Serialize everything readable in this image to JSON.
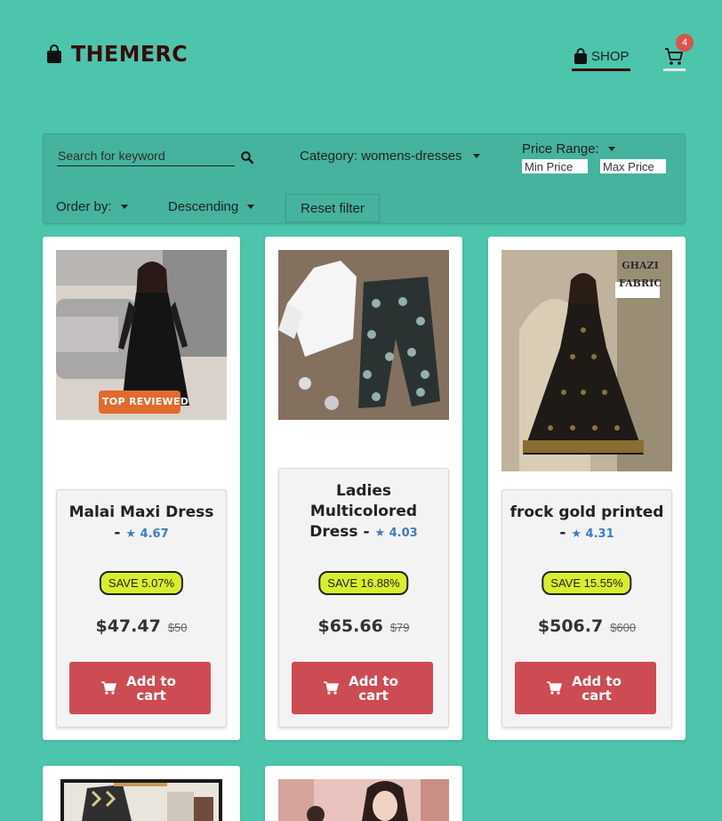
{
  "brand": {
    "name": "THEMERC",
    "icon": "shopping-bag-icon"
  },
  "nav": {
    "shop_label": "SHOP",
    "cart_count": "4"
  },
  "filters": {
    "search_placeholder": "Search for keyword",
    "category_label": "Category: womens-dresses",
    "price_range_label": "Price Range:",
    "min_price_placeholder": "Min Price",
    "max_price_placeholder": "Max Price",
    "order_by_label": "Order by:",
    "direction_label": "Descending",
    "reset_label": "Reset filter"
  },
  "products": [
    {
      "name": "Malai Maxi Dress",
      "rating": "★ 4.67",
      "save": "SAVE 5.07%",
      "price": "$47.47",
      "old_price": "$50",
      "add_label": "Add to cart",
      "image_badge": "TOP REVIEWED"
    },
    {
      "name": "Ladies Multicolored Dress",
      "rating": "★ 4.03",
      "save": "SAVE 16.88%",
      "price": "$65.66",
      "old_price": "$79",
      "add_label": "Add to cart"
    },
    {
      "name": "frock gold printed",
      "rating": "★ 4.31",
      "save": "SAVE 15.55%",
      "price": "$506.7",
      "old_price": "$600",
      "add_label": "Add to cart",
      "image_badge": "GHAZI FABRIC"
    }
  ],
  "colors": {
    "background": "#4cc5ac",
    "accent": "#cd4b52",
    "save_badge": "#d7ef2b",
    "rating": "#3d7dc6",
    "brand": "#3a0b0b"
  }
}
